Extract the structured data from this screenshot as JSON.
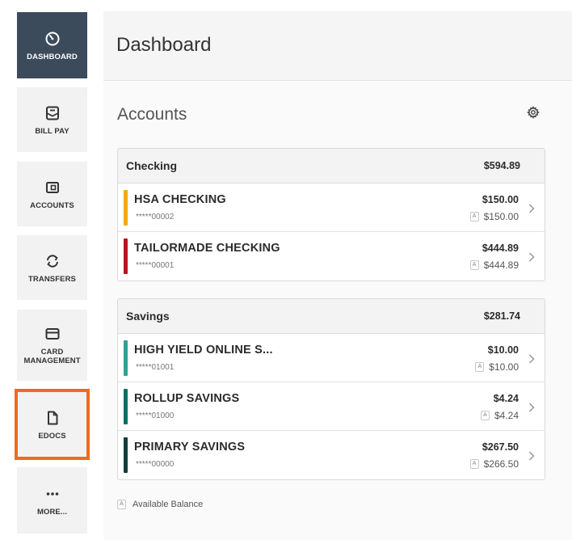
{
  "sidebar": {
    "items": [
      {
        "label": "DASHBOARD",
        "icon": "gauge-icon",
        "active": true
      },
      {
        "label": "BILL PAY",
        "icon": "bill-icon"
      },
      {
        "label": "ACCOUNTS",
        "icon": "wallet-icon"
      },
      {
        "label": "TRANSFERS",
        "icon": "transfer-icon"
      },
      {
        "label": "CARD MANAGEMENT",
        "icon": "card-icon"
      },
      {
        "label": "EDOCS",
        "icon": "document-icon",
        "highlighted": true
      },
      {
        "label": "MORE...",
        "icon": "more-icon"
      }
    ]
  },
  "header": {
    "title": "Dashboard"
  },
  "accounts": {
    "title": "Accounts",
    "settings_icon": "gear-icon",
    "groups": [
      {
        "name": "Checking",
        "total": "$594.89",
        "rows": [
          {
            "name": "HSA CHECKING",
            "number": "*****00002",
            "balance": "$150.00",
            "available": "$150.00",
            "color": "#f0a818"
          },
          {
            "name": "TAILORMADE CHECKING",
            "number": "*****00001",
            "balance": "$444.89",
            "available": "$444.89",
            "color": "#b5171f"
          }
        ]
      },
      {
        "name": "Savings",
        "total": "$281.74",
        "rows": [
          {
            "name": "HIGH YIELD ONLINE S...",
            "number": "*****01001",
            "balance": "$10.00",
            "available": "$10.00",
            "color": "#3a9c95"
          },
          {
            "name": "ROLLUP SAVINGS",
            "number": "*****01000",
            "balance": "$4.24",
            "available": "$4.24",
            "color": "#0f6e64"
          },
          {
            "name": "PRIMARY SAVINGS",
            "number": "*****00000",
            "balance": "$267.50",
            "available": "$266.50",
            "color": "#123d3a"
          }
        ]
      }
    ],
    "available_badge": "A",
    "legend_label": "Available Balance"
  },
  "colors": {
    "active_nav": "#3b4b5c",
    "highlight": "#f26a1b"
  }
}
